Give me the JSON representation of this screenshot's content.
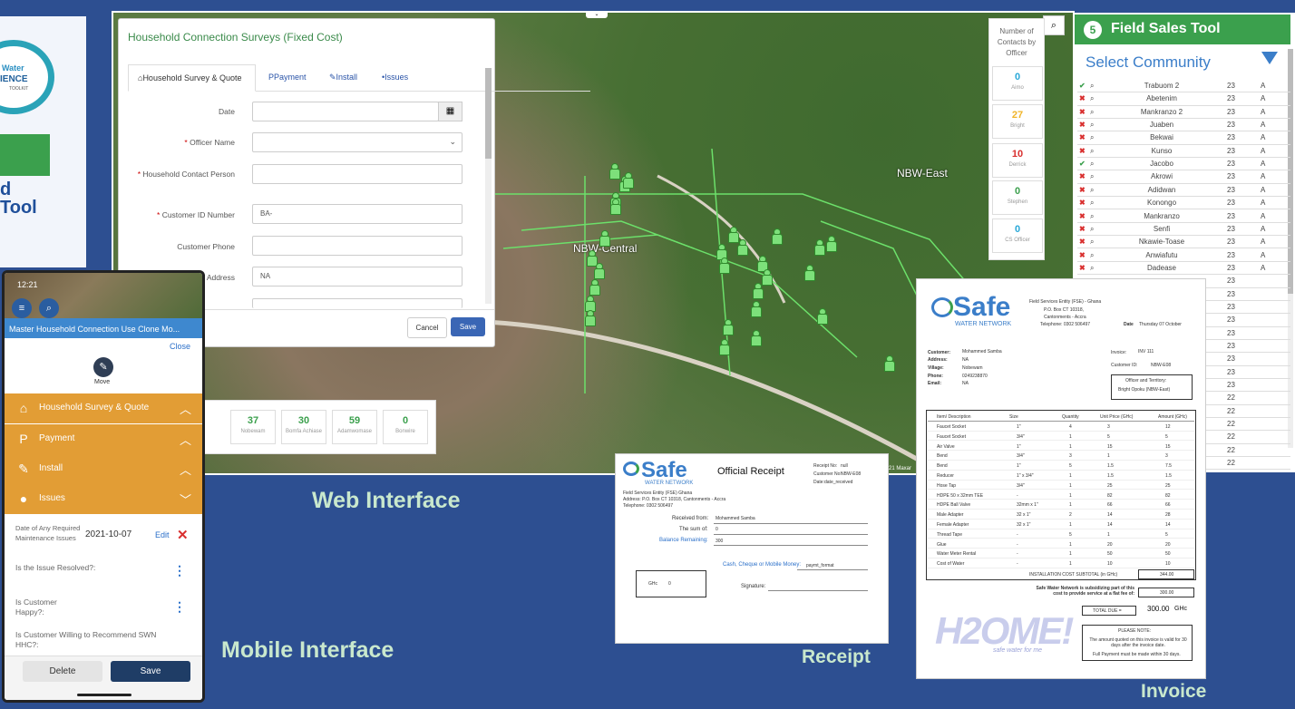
{
  "logo": {
    "brand_line1": "Water",
    "brand_line2": "IENCE",
    "brand_line3": "TOOLKIT",
    "tool_line1": "d",
    "tool_line2": "Tool"
  },
  "map": {
    "zone_central": "NBW-Central",
    "zone_east": "NBW-East",
    "attribution": "21 Maxar",
    "search_icon": "search-icon"
  },
  "survey": {
    "title": "Household Connection Surveys (Fixed Cost)",
    "tabs": [
      "Household Survey & Quote",
      "Payment",
      "Install",
      "Issues"
    ],
    "fields": [
      {
        "label": "Date",
        "required": false,
        "value": ""
      },
      {
        "label": "Officer Name",
        "required": true,
        "value": ""
      },
      {
        "label": "Household Contact Person",
        "required": true,
        "value": ""
      },
      {
        "label": "Customer ID Number",
        "required": true,
        "value": "BA-"
      },
      {
        "label": "Customer Phone",
        "required": false,
        "value": ""
      },
      {
        "label": "Address",
        "required": false,
        "value": "NA"
      }
    ],
    "cancel": "Cancel",
    "save": "Save"
  },
  "contacts": {
    "title": "Number of Contacts by Officer",
    "items": [
      {
        "count": "0",
        "name": "Aimo",
        "color": "#29a8d8"
      },
      {
        "count": "27",
        "name": "Bright",
        "color": "#f0b429"
      },
      {
        "count": "10",
        "name": "Derrick",
        "color": "#d9302f"
      },
      {
        "count": "0",
        "name": "Stephen",
        "color": "#3ba04d"
      },
      {
        "count": "0",
        "name": "CS Officer",
        "color": "#29a8d8"
      }
    ]
  },
  "stats": [
    {
      "count": "37",
      "name": "Nobewam"
    },
    {
      "count": "30",
      "name": "Bomfa Achiase"
    },
    {
      "count": "59",
      "name": "Adamwomase"
    },
    {
      "count": "0",
      "name": "Bonwire"
    }
  ],
  "fst": {
    "number": "5",
    "title": "Field Sales Tool",
    "select_label": "Select Community",
    "rows": [
      {
        "name": "Trabuom 2",
        "count": "23",
        "grade": "A",
        "done": true
      },
      {
        "name": "Abetenim",
        "count": "23",
        "grade": "A",
        "done": false
      },
      {
        "name": "Mankranzo 2",
        "count": "23",
        "grade": "A",
        "done": false
      },
      {
        "name": "Juaben",
        "count": "23",
        "grade": "A",
        "done": false
      },
      {
        "name": "Bekwai",
        "count": "23",
        "grade": "A",
        "done": false
      },
      {
        "name": "Kunso",
        "count": "23",
        "grade": "A",
        "done": false
      },
      {
        "name": "Jacobo",
        "count": "23",
        "grade": "A",
        "done": true
      },
      {
        "name": "Akrowi",
        "count": "23",
        "grade": "A",
        "done": false
      },
      {
        "name": "Adidwan",
        "count": "23",
        "grade": "A",
        "done": false
      },
      {
        "name": "Konongo",
        "count": "23",
        "grade": "A",
        "done": false
      },
      {
        "name": "Mankranzo",
        "count": "23",
        "grade": "A",
        "done": false
      },
      {
        "name": "Senfi",
        "count": "23",
        "grade": "A",
        "done": false
      },
      {
        "name": "Nkawie-Toase",
        "count": "23",
        "grade": "A",
        "done": false
      },
      {
        "name": "Anwiafutu",
        "count": "23",
        "grade": "A",
        "done": false
      },
      {
        "name": "Dadease",
        "count": "23",
        "grade": "A",
        "done": false
      }
    ],
    "more_counts": [
      "23",
      "23",
      "23",
      "23",
      "23",
      "23",
      "23",
      "23",
      "23",
      "22",
      "22",
      "22",
      "22",
      "22",
      "22",
      "22",
      "22",
      "22",
      "22",
      "22",
      "22",
      "22",
      "22",
      "22",
      "22",
      "22",
      "22",
      "22"
    ]
  },
  "mobile": {
    "time": "12:21",
    "title": "Master Household Connection Use Clone Mo...",
    "close": "Close",
    "move": "Move",
    "sections": [
      {
        "label": "Household Survey & Quote",
        "icon": "home-icon",
        "open": true
      },
      {
        "label": "Payment",
        "icon": "paypal-icon",
        "open": true
      },
      {
        "label": "Install",
        "icon": "wrench-icon",
        "open": true
      },
      {
        "label": "Issues",
        "icon": "water-drop-icon",
        "open": false
      }
    ],
    "date_label": "Date of Any Required Maintenance Issues",
    "date_value": "2021-10-07",
    "edit": "Edit",
    "q1": "Is the Issue Resolved?:",
    "q2": "Is Customer Happy?:",
    "q3": "Is Customer Willing to Recommend SWN HHC?:",
    "delete": "Delete",
    "save": "Save"
  },
  "captions": {
    "web": "Web Interface",
    "mobile": "Mobile Interface",
    "receipt": "Receipt",
    "invoice": "Invoice"
  },
  "receipt": {
    "brand": "Safe",
    "brand_sub": "WATER NETWORK",
    "title": "Official Receipt",
    "entity": "Field Services Entity (FSE) Ghana",
    "address": "Address: P.O. Box CT 10318, Cantonments - Accra",
    "telephone": "Telephone: 0302 506497",
    "receipt_no": "Receipt No:",
    "receipt_no_val": "null",
    "customer_no": "Customer No:",
    "customer_no_val": "NBW-E08",
    "date_label": "Date:",
    "date_val": "date_received",
    "received_from": "Received from:",
    "received_from_val": "Mohammed Samba",
    "sum_of": "The sum of:",
    "sum_val": "0",
    "balance": "Balance Remaining:",
    "balance_val": "300",
    "method": "Cash, Cheque or Mobile Money:",
    "method_val": "paymt_format",
    "ghc": "GHc",
    "ghc_val": "0",
    "signature": "Signature:"
  },
  "invoice": {
    "brand": "Safe",
    "brand_sub": "WATER NETWORK",
    "entity": "Field Services Entity (FSE) - Ghana",
    "po": "P.O. Box CT 10318,",
    "city": "Cantonments - Accra",
    "telephone": "Telephone: 0302 506497",
    "date_label": "Date",
    "date_val": "Thursday 07 October",
    "customer_label": "Customer:",
    "customer_val": "Mohammed Samba",
    "address_label": "Address:",
    "address_val": "NA",
    "village_label": "Village:",
    "village_val": "Nobewam",
    "phone_label": "Phone:",
    "phone_val": "0249238870",
    "email_label": "Email:",
    "email_val": "NA",
    "invoice_label": "Invoice:",
    "invoice_val": "INV 111",
    "customer_id_label": "Customer ID:",
    "customer_id_val": "NBW-E08",
    "officer_label": "Officer and Territory:",
    "officer_val": "Bright Opoku (NBW-East)",
    "columns": [
      "Item/ Description",
      "Size",
      "Quantity",
      "Unit Price (GHc)",
      "Amount (GHc)"
    ],
    "items": [
      [
        "Faucet Socket",
        "1\"",
        "4",
        "3",
        "12"
      ],
      [
        "Faucet Socket",
        "3/4\"",
        "1",
        "5",
        "5"
      ],
      [
        "Air Valve",
        "1\"",
        "1",
        "15",
        "15"
      ],
      [
        "Bend",
        "3/4\"",
        "3",
        "1",
        "3"
      ],
      [
        "Bend",
        "1\"",
        "5",
        "1.5",
        "7.5"
      ],
      [
        "Reducer",
        "1\" x 3/4\"",
        "1",
        "1.5",
        "1.5"
      ],
      [
        "Hose Tap",
        "3/4\"",
        "1",
        "25",
        "25"
      ],
      [
        "HDPE 50 x 32mm TEE",
        "-",
        "1",
        "82",
        "82"
      ],
      [
        "HDPE Ball Valve",
        "32mm x 1\"",
        "1",
        "66",
        "66"
      ],
      [
        "Male Adapter",
        "32 x 1\"",
        "2",
        "14",
        "28"
      ],
      [
        "Female Adapter",
        "32 x 1\"",
        "1",
        "14",
        "14"
      ],
      [
        "Thread Tape",
        "-",
        "5",
        "1",
        "5"
      ],
      [
        "Glue",
        "-",
        "1",
        "20",
        "20"
      ],
      [
        "Water Meter Rental",
        "-",
        "1",
        "50",
        "50"
      ],
      [
        "Cost of Water",
        "-",
        "1",
        "10",
        "10"
      ]
    ],
    "subtotal_label": "INSTALLATION COST SUBTOTAL (in GHc)",
    "subtotal_val": "344.00",
    "subsidy_text": "Safe Water Network is subsidizing part of this cost to provide service at a flat fee of:",
    "subsidy_val": "300.00",
    "total_label": "TOTAL DUE =",
    "total_val": "300.00",
    "currency": "GHc",
    "h2ome": "H2OME!",
    "h2ome_sub": "safe water for me",
    "note_title": "PLEASE NOTE:",
    "note1": "The amount quoted on this invoice is valid for 30 days after the invoice date.",
    "note2": "Full Payment must be made within 30 days."
  },
  "colors": {
    "accent_green": "#3ba04d",
    "navy": "#2d4f91",
    "orange": "#e29d35",
    "blue_button": "#3a66b5"
  }
}
